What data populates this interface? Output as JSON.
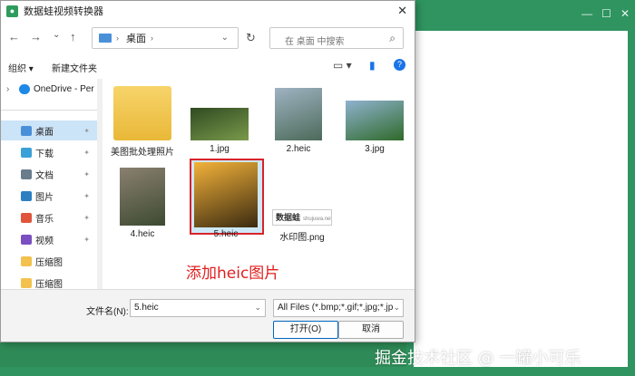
{
  "background_window": {
    "controls": [
      "—",
      "☐",
      "✕"
    ]
  },
  "dialog": {
    "title": "数据蛙视频转换器",
    "app_icon_glyph": "●",
    "close_glyph": "✕"
  },
  "nav": {
    "back": "←",
    "forward": "→",
    "recent": "⌄",
    "up": "↑",
    "address_crumb": "桌面",
    "address_sep": "›",
    "address_chevron": "⌄",
    "refresh": "↻",
    "search_placeholder": "在 桌面 中搜索",
    "search_glyph": "⌕"
  },
  "commands": {
    "organize": "组织 ▾",
    "new_folder": "新建文件夹",
    "view": "▭ ▾",
    "preview_pane": "▮",
    "help": "?"
  },
  "sidebar": {
    "onedrive": "OneDrive - Per",
    "expand_glyph": "›",
    "pin_glyph": "✦",
    "items": [
      {
        "label": "桌面",
        "color": "#4a90d9",
        "pinned": true,
        "selected": true
      },
      {
        "label": "下载",
        "color": "#3aa0d8",
        "pinned": true
      },
      {
        "label": "文档",
        "color": "#6a7c8c",
        "pinned": true
      },
      {
        "label": "图片",
        "color": "#2d7fc1",
        "pinned": true
      },
      {
        "label": "音乐",
        "color": "#e0553b",
        "pinned": true
      },
      {
        "label": "视频",
        "color": "#7a4fc2",
        "pinned": true
      },
      {
        "label": "压缩图",
        "color": "#f2c14e",
        "pinned": false
      },
      {
        "label": "压缩图",
        "color": "#f2c14e",
        "pinned": false
      }
    ]
  },
  "files": [
    {
      "name": "美图批处理照片",
      "kind": "folder"
    },
    {
      "name": "1.jpg",
      "kind": "image",
      "c1": "#2f4a22",
      "c2": "#7a9a4a"
    },
    {
      "name": "2.heic",
      "kind": "image",
      "c1": "#9fb3c2",
      "c2": "#4c6a5a"
    },
    {
      "name": "3.jpg",
      "kind": "image",
      "c1": "#8fb2cf",
      "c2": "#2f6a2a"
    },
    {
      "name": "4.heic",
      "kind": "image",
      "c1": "#8a8070",
      "c2": "#3d4a32"
    },
    {
      "name": "5.heic",
      "kind": "image",
      "c1": "#f3b23a",
      "c2": "#3a2a10",
      "selected": true
    },
    {
      "name": "水印图.png",
      "kind": "watermark",
      "stamp": "数据蛙",
      "stamp_small": "shujuwa.net"
    }
  ],
  "annotation": "添加heic图片",
  "footer": {
    "filename_label": "文件名(N):",
    "filename_value": "5.heic",
    "filetype_value": "All Files (*.bmp;*.gif;*.jpg;*.jp",
    "chevron": "⌄",
    "open_button": "打开(O)",
    "cancel_button": "取消"
  },
  "watermark": "掘金技术社区 @ 一罐小可乐"
}
